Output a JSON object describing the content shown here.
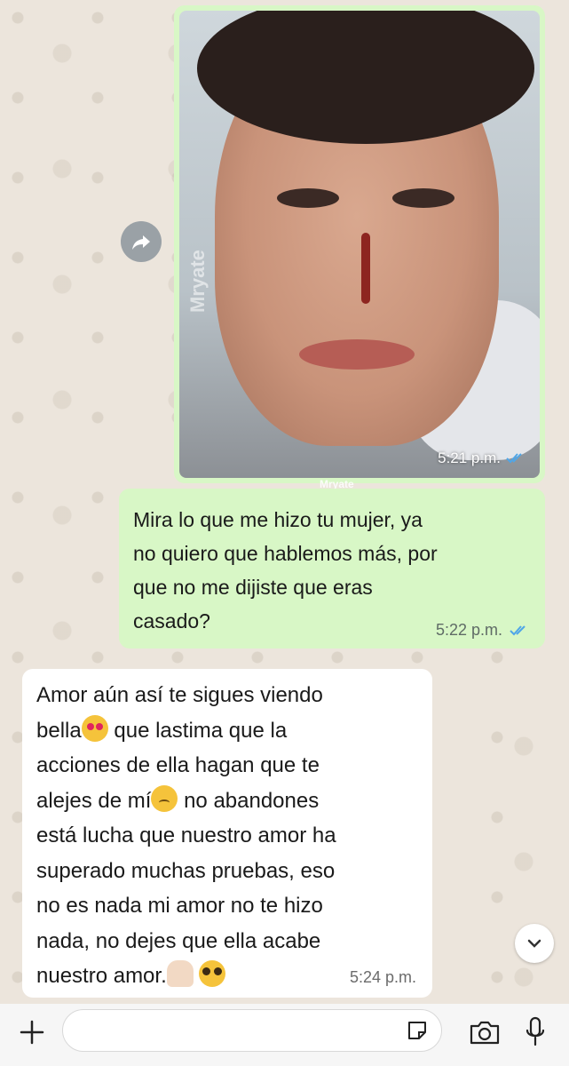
{
  "messages": {
    "image_message": {
      "time": "5:21 p.m.",
      "watermark": "Mryate",
      "status": "read"
    },
    "outgoing_text": {
      "lines": [
        "Mira lo que me hizo tu mujer, ya",
        "no quiero que hablemos más, por",
        "que no me dijiste que eras",
        "casado?"
      ],
      "time": "5:22 p.m.",
      "status": "read"
    },
    "incoming_text": {
      "line1": "Amor aún así te sigues viendo",
      "line2_before": "bella",
      "line2_after": " que lastima que la",
      "line3": "acciones de ella hagan que te",
      "line4_before": "alejes de mí",
      "line4_after": " no abandones",
      "line5": "está lucha que nuestro amor ha",
      "line6": "superado muchas pruebas, eso",
      "line7": "no es nada mi amor no te hizo",
      "line8": "nada, no dejes que ella acabe",
      "line9": "nuestro amor.",
      "time": "5:24 p.m."
    }
  },
  "icons": {
    "forward": "forward-icon",
    "read_receipt": "double-check-icon",
    "scroll_down": "chevron-down-icon",
    "attach": "plus-icon",
    "sticker": "sticker-icon",
    "camera": "camera-icon",
    "mic": "mic-icon"
  },
  "colors": {
    "outgoing_bubble": "#d8f7c6",
    "incoming_bubble": "#ffffff",
    "read_tick": "#4fa6e8",
    "wallpaper": "#ece5dc"
  }
}
